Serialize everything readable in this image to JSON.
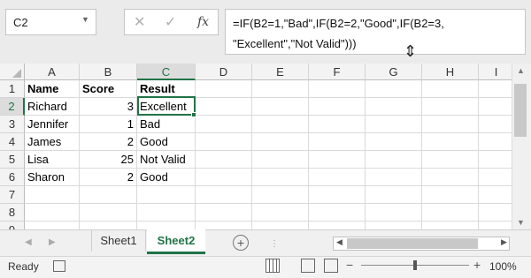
{
  "name_box": {
    "value": "C2"
  },
  "formula_bar": {
    "cancel_icon": "cancel-x-icon",
    "enter_icon": "checkmark-icon",
    "fx_label": "fx",
    "formula_line1": "=IF(B2=1,\"Bad\",IF(B2=2,\"Good\",IF(B2=3,",
    "formula_line2": "\"Excellent\",\"Not Valid\")))"
  },
  "columns": [
    "A",
    "B",
    "C",
    "D",
    "E",
    "F",
    "G",
    "H",
    "I"
  ],
  "rows": [
    "1",
    "2",
    "3",
    "4",
    "5",
    "6",
    "7",
    "8",
    "9"
  ],
  "cells": {
    "A1": "Name",
    "B1": "Score",
    "C1": "Result",
    "A2": "Richard",
    "B2": "3",
    "C2": "Excellent",
    "A3": "Jennifer",
    "B3": "1",
    "C3": "Bad",
    "A4": "James",
    "B4": "2",
    "C4": "Good",
    "A5": "Lisa",
    "B5": "25",
    "C5": "Not Valid",
    "A6": "Sharon",
    "B6": "2",
    "C6": "Good"
  },
  "selected_cell": "C2",
  "sheet_tabs": [
    {
      "label": "Sheet1",
      "active": false
    },
    {
      "label": "Sheet2",
      "active": true
    }
  ],
  "status_bar": {
    "status_text": "Ready",
    "zoom_level": "100%",
    "zoom_fraction": 0.5
  },
  "colors": {
    "accent": "#217346",
    "header_bg": "#f3f3f3",
    "gridline": "#dadada"
  }
}
